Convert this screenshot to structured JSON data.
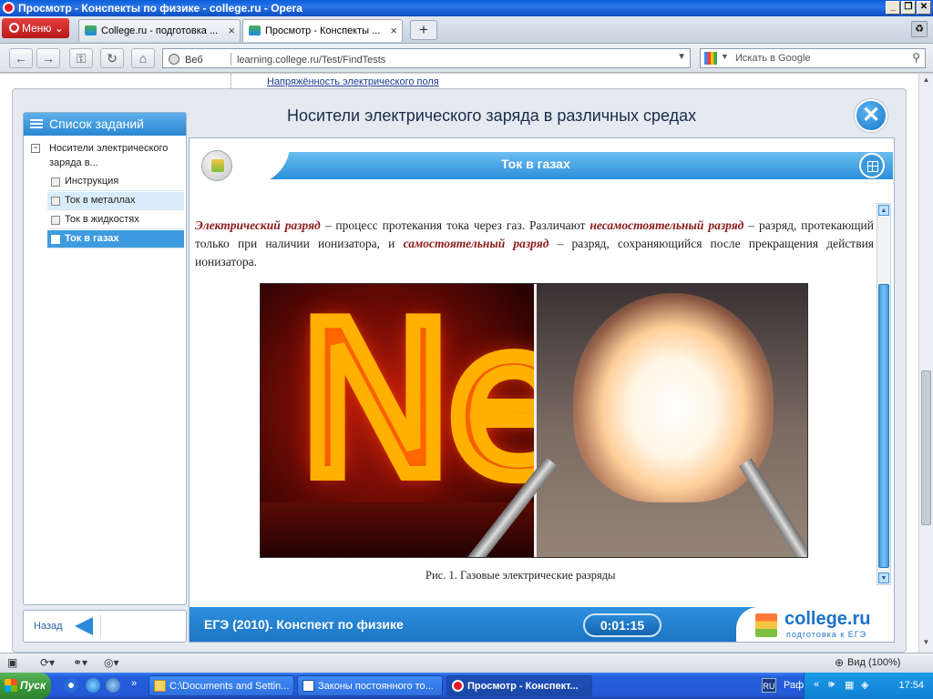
{
  "window": {
    "title": "Просмотр - Конспекты по физике - college.ru - Opera"
  },
  "browser": {
    "menu_label": "Меню",
    "tabs": [
      {
        "label": "College.ru - подготовка ..."
      },
      {
        "label": "Просмотр - Конспекты ..."
      }
    ],
    "address": {
      "scheme_label": "Веб",
      "url": "learning.college.ru/Test/FindTests"
    },
    "search_placeholder": "Искать в Google",
    "bg_link": "Напряжённость электрического поля",
    "zoom_label": "Вид (100%)"
  },
  "app": {
    "title": "Носители электрического заряда в различных средах",
    "sidebar": {
      "header": "Список заданий",
      "root": "Носители электрического заряда в...",
      "items": [
        {
          "label": "Инструкция",
          "state": "normal"
        },
        {
          "label": "Ток в металлах",
          "state": "hover"
        },
        {
          "label": "Ток в жидкостях",
          "state": "normal"
        },
        {
          "label": "Ток в газах",
          "state": "active"
        }
      ],
      "back_label": "Назад"
    },
    "content": {
      "header": "Ток в газах",
      "paragraph": {
        "term1": "Электрический разряд",
        "t1": " – процесс протекания тока через газ. Различают ",
        "term2": "несамостоятельный разряд",
        "t2": " – разряд, протекающий только при наличии ионизатора, и ",
        "term3": "самостоятельный разряд",
        "t3": " – разряд, сохраняющийся после прекращения действия ионизатора."
      },
      "figure_letters": "Ne",
      "caption": "Рис. 1. Газовые электрические разряды"
    },
    "footer": {
      "course": "ЕГЭ (2010). Конспект по физике",
      "timer": "0:01:15",
      "logo_name": "college.ru",
      "logo_sub": "подготовка к ЕГЭ"
    }
  },
  "taskbar": {
    "start_label": "Пуск",
    "buttons": [
      {
        "label": "C:\\Documents and Settin...",
        "active": false
      },
      {
        "label": "Законы постоянного то...",
        "active": false
      },
      {
        "label": "Просмотр - Конспект...",
        "active": true
      }
    ],
    "lang": "RU",
    "user": "Рафаиль",
    "clock": "17:54"
  }
}
